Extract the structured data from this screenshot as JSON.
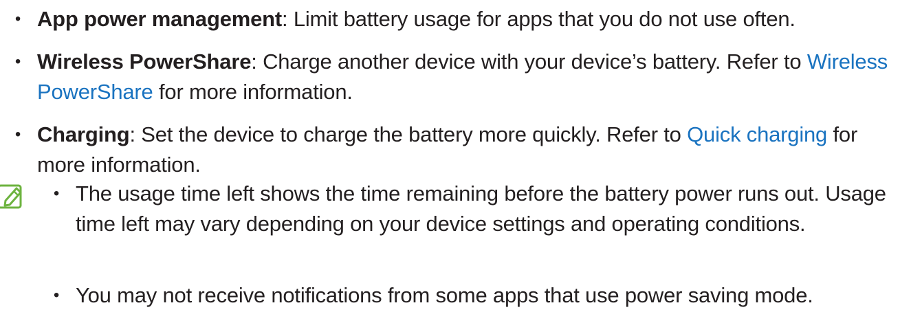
{
  "settings_list": [
    {
      "term": "App power management",
      "description": ": Limit battery usage for apps that you do not use often."
    },
    {
      "term": "Wireless PowerShare",
      "description_before_link": ": Charge another device with your device’s battery. Refer to ",
      "link": "Wireless PowerShare",
      "description_after_link": " for more information."
    },
    {
      "term": "Charging",
      "description_before_link": ": Set the device to charge the battery more quickly. Refer to ",
      "link": "Quick charging",
      "description_after_link": " for more information."
    }
  ],
  "note": {
    "icon": "note-pen-icon",
    "items": [
      "The usage time left shows the time remaining before the battery power runs out. Usage time left may vary depending on your device settings and operating conditions.",
      "You may not receive notifications from some apps that use power saving mode."
    ]
  },
  "colors": {
    "text": "#231f20",
    "link": "#1a73c0",
    "icon": "#6db33f"
  }
}
